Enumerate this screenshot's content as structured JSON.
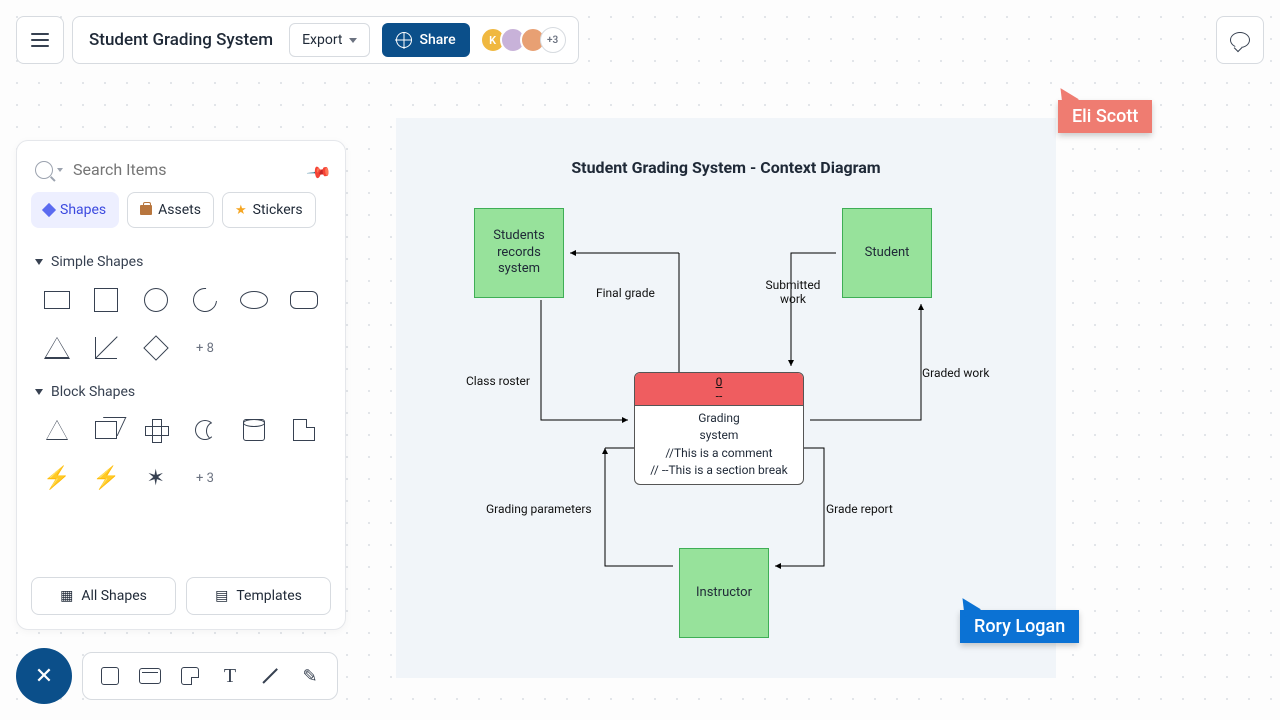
{
  "header": {
    "title": "Student Grading System",
    "export_label": "Export",
    "share_label": "Share",
    "avatar_more": "+3"
  },
  "panel": {
    "search_placeholder": "Search Items",
    "tabs": {
      "shapes": "Shapes",
      "assets": "Assets",
      "stickers": "Stickers"
    },
    "sections": {
      "simple": "Simple Shapes",
      "simple_more": "+ 8",
      "block": "Block Shapes",
      "block_more": "+ 3"
    },
    "actions": {
      "all_shapes": "All Shapes",
      "templates": "Templates"
    }
  },
  "diagram": {
    "title": "Student Grading System - Context Diagram",
    "nodes": {
      "records": "Students records system",
      "student": "Student",
      "instructor": "Instructor",
      "center_top_num": "0",
      "center_top_dash": "--",
      "center_line1": "Grading",
      "center_line2": "system",
      "center_line3": "//This is a comment",
      "center_line4": "// --This is a section break"
    },
    "edges": {
      "final_grade": "Final grade",
      "class_roster": "Class roster",
      "submitted_work": "Submitted work",
      "graded_work": "Graded work",
      "grading_parameters": "Grading parameters",
      "grade_report": "Grade report"
    }
  },
  "collaborators": {
    "eli": "Eli Scott",
    "rory": "Rory Logan"
  }
}
